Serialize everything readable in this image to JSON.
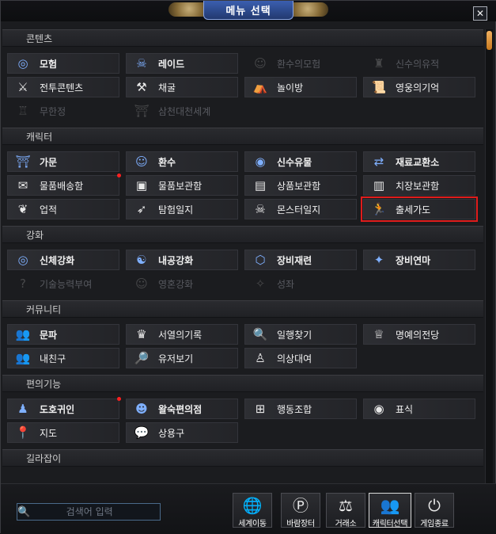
{
  "window": {
    "title": "메뉴 선택",
    "close_label": "✕"
  },
  "sections": [
    {
      "key": "content",
      "title": "콘텐츠",
      "items": [
        {
          "label": "모험",
          "icon": "swirl-icon",
          "glyph": "◎",
          "color": "blue",
          "dim": false,
          "bold": true
        },
        {
          "label": "레이드",
          "icon": "demon-mask-icon",
          "glyph": "☠",
          "color": "blue",
          "dim": false,
          "bold": true
        },
        {
          "label": "환수의모험",
          "icon": "beast-face-icon",
          "glyph": "☺",
          "color": "gray",
          "dim": true
        },
        {
          "label": "신수의유적",
          "icon": "ruins-icon",
          "glyph": "♜",
          "color": "gray",
          "dim": true
        },
        {
          "label": "전투콘텐츠",
          "icon": "crossed-swords-icon",
          "glyph": "⚔",
          "color": "white",
          "dim": false
        },
        {
          "label": "채굴",
          "icon": "pickaxe-icon",
          "glyph": "⚒",
          "color": "white",
          "dim": false
        },
        {
          "label": "놀이방",
          "icon": "playground-icon",
          "glyph": "⛺",
          "color": "white",
          "dim": false
        },
        {
          "label": "영웅의기억",
          "icon": "scroll-icon",
          "glyph": "📜",
          "color": "white",
          "dim": false
        },
        {
          "label": "무한정",
          "icon": "tower-icon",
          "glyph": "♖",
          "color": "gray",
          "dim": true
        },
        {
          "label": "삼천대천세계",
          "icon": "temple-icon",
          "glyph": "⛩",
          "color": "gray",
          "dim": true
        }
      ]
    },
    {
      "key": "character",
      "title": "캐릭터",
      "items": [
        {
          "label": "가문",
          "icon": "palace-icon",
          "glyph": "⛩",
          "color": "blue",
          "dim": false,
          "bold": true
        },
        {
          "label": "환수",
          "icon": "spirit-beast-icon",
          "glyph": "☺",
          "color": "blue",
          "dim": false,
          "bold": true
        },
        {
          "label": "신수유물",
          "icon": "relic-orb-icon",
          "glyph": "◉",
          "color": "blue",
          "dim": false,
          "bold": true
        },
        {
          "label": "재료교환소",
          "icon": "exchange-icon",
          "glyph": "⇄",
          "color": "blue",
          "dim": false,
          "bold": true
        },
        {
          "label": "물품배송함",
          "icon": "delivery-box-icon",
          "glyph": "✉",
          "color": "white",
          "dim": false,
          "dot": true
        },
        {
          "label": "물품보관함",
          "icon": "storage-chest-icon",
          "glyph": "▣",
          "color": "white",
          "dim": false
        },
        {
          "label": "상품보관함",
          "icon": "gift-chest-icon",
          "glyph": "▤",
          "color": "white",
          "dim": false
        },
        {
          "label": "치장보관함",
          "icon": "wardrobe-chest-icon",
          "glyph": "▥",
          "color": "white",
          "dim": false
        },
        {
          "label": "업적",
          "icon": "laurel-icon",
          "glyph": "❦",
          "color": "white",
          "dim": false
        },
        {
          "label": "탐험일지",
          "icon": "explorer-icon",
          "glyph": "➶",
          "color": "white",
          "dim": false
        },
        {
          "label": "몬스터일지",
          "icon": "monster-mask-icon",
          "glyph": "☠",
          "color": "white",
          "dim": false
        },
        {
          "label": "출세가도",
          "icon": "runner-icon",
          "glyph": "🏃",
          "color": "white",
          "dim": false,
          "highlight": true
        }
      ]
    },
    {
      "key": "enhance",
      "title": "강화",
      "items": [
        {
          "label": "신체강화",
          "icon": "body-orb-icon",
          "glyph": "◎",
          "color": "blue",
          "dim": false,
          "bold": true
        },
        {
          "label": "내공강화",
          "icon": "meditation-icon",
          "glyph": "☯",
          "color": "blue",
          "dim": false,
          "bold": true
        },
        {
          "label": "장비재련",
          "icon": "hexagon-gear-icon",
          "glyph": "⬡",
          "color": "blue",
          "dim": false,
          "bold": true
        },
        {
          "label": "장비연마",
          "icon": "crystal-icon",
          "glyph": "✦",
          "color": "blue",
          "dim": false,
          "bold": true
        },
        {
          "label": "기술능력부여",
          "icon": "question-icon",
          "glyph": "?",
          "color": "gray",
          "dim": true
        },
        {
          "label": "영혼강화",
          "icon": "soul-icon",
          "glyph": "☺",
          "color": "gray",
          "dim": true
        },
        {
          "label": "성좌",
          "icon": "constellation-icon",
          "glyph": "✧",
          "color": "gray",
          "dim": true
        }
      ]
    },
    {
      "key": "community",
      "title": "커뮤니티",
      "items": [
        {
          "label": "문파",
          "icon": "guild-icon",
          "glyph": "👥",
          "color": "blue",
          "dim": false,
          "bold": true
        },
        {
          "label": "서열의기록",
          "icon": "ranking-icon",
          "glyph": "♛",
          "color": "white",
          "dim": false
        },
        {
          "label": "일행찾기",
          "icon": "party-search-icon",
          "glyph": "🔍",
          "color": "white",
          "dim": false
        },
        {
          "label": "명예의전당",
          "icon": "trophy-icon",
          "glyph": "♕",
          "color": "white",
          "dim": false
        },
        {
          "label": "내친구",
          "icon": "friends-icon",
          "glyph": "👥",
          "color": "white",
          "dim": false
        },
        {
          "label": "유저보기",
          "icon": "user-search-icon",
          "glyph": "🔎",
          "color": "white",
          "dim": false
        },
        {
          "label": "의상대여",
          "icon": "costume-icon",
          "glyph": "♙",
          "color": "white",
          "dim": false
        }
      ]
    },
    {
      "key": "convenience",
      "title": "편의기능",
      "items": [
        {
          "label": "도호귀인",
          "icon": "helper-icon",
          "glyph": "♟",
          "color": "blue",
          "dim": false,
          "bold": true,
          "dot": true
        },
        {
          "label": "왈숙편의점",
          "icon": "shop-mascot-icon",
          "glyph": "☻",
          "color": "blue",
          "dim": false,
          "bold": true
        },
        {
          "label": "행동조합",
          "icon": "action-combo-icon",
          "glyph": "⊞",
          "color": "white",
          "dim": false
        },
        {
          "label": "표식",
          "icon": "target-mark-icon",
          "glyph": "◉",
          "color": "white",
          "dim": false
        },
        {
          "label": "지도",
          "icon": "map-pin-icon",
          "glyph": "📍",
          "color": "white",
          "dim": false
        },
        {
          "label": "상용구",
          "icon": "chat-bubble-icon",
          "glyph": "💬",
          "color": "white",
          "dim": false
        }
      ]
    },
    {
      "key": "guide",
      "title": "길라잡이",
      "items": []
    }
  ],
  "search": {
    "placeholder": "검색어 입력",
    "value": ""
  },
  "bottom_buttons": [
    {
      "label": "세계이동",
      "icon": "globe-icon",
      "glyph": "🌐",
      "active": false
    },
    {
      "label": "바람장터",
      "icon": "market-p-icon",
      "glyph": "Ⓟ",
      "active": false
    },
    {
      "label": "거래소",
      "icon": "scales-icon",
      "glyph": "⚖",
      "active": false
    },
    {
      "label": "캐릭터선택",
      "icon": "character-select-icon",
      "glyph": "👥",
      "active": true
    },
    {
      "label": "게임종료",
      "icon": "power-icon",
      "glyph": "⏻",
      "active": false
    }
  ],
  "colors": {
    "accent_blue": "#7fb0ff",
    "highlight_red": "#e01c1c",
    "notify_red": "#ff2020",
    "scroll_thumb": "#e09a40"
  }
}
